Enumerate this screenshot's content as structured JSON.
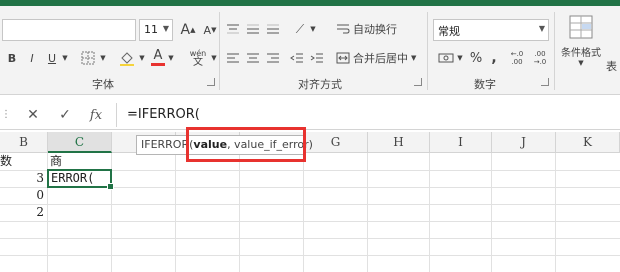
{
  "ribbon": {
    "font_size": "11",
    "font_group_label": "字体",
    "alignment_group_label": "对齐方式",
    "number_group_label": "数字",
    "wrap_text_label": "自动换行",
    "merge_center_label": "合并后居中",
    "number_format_value": "常规",
    "percent_symbol": "%",
    "comma_symbol": ",",
    "conditional_format_label": "条件格式",
    "table_label": "表",
    "bold": "B",
    "italic": "I",
    "underline": "U",
    "wen_label": "wén",
    "font_color_letter": "A",
    "grow_font": "A",
    "shrink_font": "A",
    "decimal_increase": "←.0\n.00",
    "decimal_decrease": ".00\n→.0"
  },
  "formula_bar": {
    "cancel_symbol": "✕",
    "enter_symbol": "✓",
    "fx_label": "fx",
    "formula": "=IFERROR("
  },
  "columns": [
    "B",
    "C",
    "D",
    "E",
    "F",
    "G",
    "H",
    "I",
    "J",
    "K"
  ],
  "active_column": "C",
  "cells": {
    "b1": "数",
    "c1": "商",
    "b2": "3",
    "c2": "ERROR(",
    "b3": "0",
    "b4": "2"
  },
  "tooltip": {
    "function_name": "IFERROR(",
    "arg_current": "value",
    "arg_rest": ", value_if_error)"
  },
  "colors": {
    "accent_green": "#217346",
    "highlight_red": "#e8322f"
  }
}
